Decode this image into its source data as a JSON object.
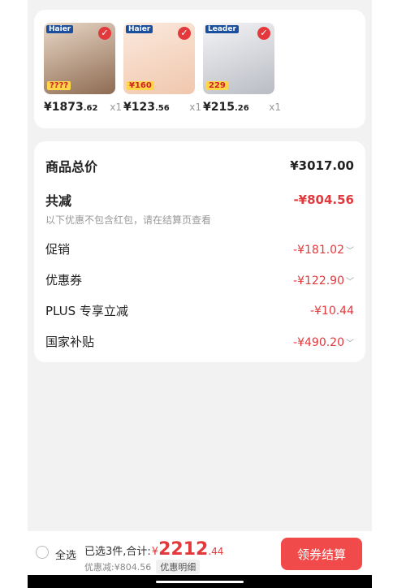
{
  "products": [
    {
      "brand": "Haier",
      "tag": "????",
      "price_int": "¥1873",
      "price_dec": ".62",
      "qty": "x1",
      "color": "#c9a98c"
    },
    {
      "brand": "Haier",
      "tag": "¥160",
      "price_int": "¥123",
      "price_dec": ".56",
      "qty": "x1",
      "color": "#f6d8c4"
    },
    {
      "brand": "Leader",
      "tag": "229",
      "price_int": "¥215",
      "price_dec": ".26",
      "qty": "x1",
      "color": "#d9d9de"
    }
  ],
  "summary": {
    "total_label": "商品总价",
    "total_value": "¥3017.00",
    "reduce_label": "共减",
    "reduce_value": "-¥804.56",
    "note": "以下优惠不包含红包，请在结算页查看",
    "items": [
      {
        "label": "促销",
        "value": "-¥181.02",
        "chevron": true
      },
      {
        "label": "优惠券",
        "value": "-¥122.90",
        "chevron": true
      },
      {
        "label": "PLUS 专享立减",
        "value": "-¥10.44",
        "chevron": false
      },
      {
        "label": "国家补贴",
        "value": "-¥490.20",
        "chevron": true
      }
    ]
  },
  "bottom": {
    "select_all": "全选",
    "selected": "已选3件,合计:",
    "currency": "¥",
    "total_int": "2212",
    "total_dec": ".44",
    "discount": "优惠减:¥804.56",
    "detail": "优惠明细",
    "checkout": "领券结算"
  },
  "colors": {
    "accent": "#e4393c",
    "checkout_bg": "#f14a4a"
  }
}
